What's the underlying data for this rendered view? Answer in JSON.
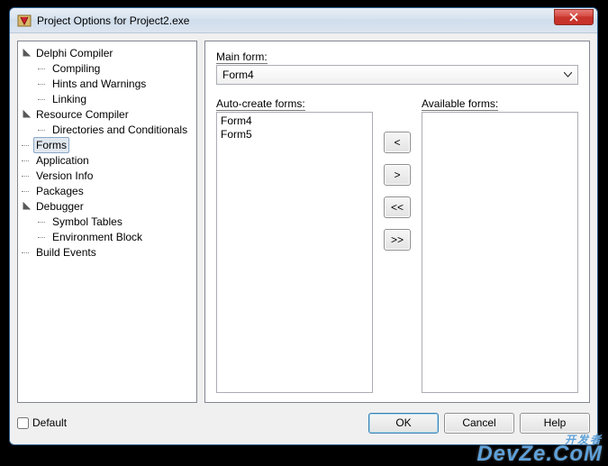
{
  "window": {
    "title": "Project Options for Project2.exe"
  },
  "tree": [
    {
      "label": "Delphi Compiler",
      "expanded": true,
      "children": [
        {
          "label": "Compiling"
        },
        {
          "label": "Hints and Warnings"
        },
        {
          "label": "Linking"
        }
      ]
    },
    {
      "label": "Resource Compiler",
      "expanded": true,
      "children": [
        {
          "label": "Directories and Conditionals"
        }
      ]
    },
    {
      "label": "Forms",
      "selected": true
    },
    {
      "label": "Application"
    },
    {
      "label": "Version Info"
    },
    {
      "label": "Packages"
    },
    {
      "label": "Debugger",
      "expanded": true,
      "children": [
        {
          "label": "Symbol Tables"
        },
        {
          "label": "Environment Block"
        }
      ]
    },
    {
      "label": "Build Events"
    }
  ],
  "forms_page": {
    "main_form_label": "Main form:",
    "main_form_value": "Form4",
    "autocreate_label": "Auto-create forms:",
    "available_label": "Available forms:",
    "autocreate_items": [
      "Form4",
      "Form5"
    ],
    "available_items": [],
    "btn_left": "<",
    "btn_right": ">",
    "btn_all_left": "<<",
    "btn_all_right": ">>"
  },
  "bottom": {
    "default_label": "Default",
    "ok": "OK",
    "cancel": "Cancel",
    "help": "Help"
  },
  "watermark": {
    "line1": "开发者",
    "line2": "DevZe.CoM"
  }
}
